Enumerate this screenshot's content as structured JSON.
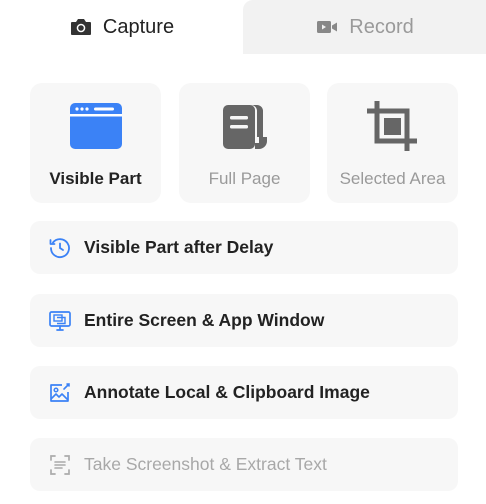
{
  "tabs": {
    "capture": {
      "label": "Capture",
      "icon": "camera-icon"
    },
    "record": {
      "label": "Record",
      "icon": "video-camera-icon"
    }
  },
  "cards": [
    {
      "label": "Visible Part",
      "icon": "browser-window-icon",
      "color": "#3b82f6",
      "enabled": true
    },
    {
      "label": "Full Page",
      "icon": "scroll-page-icon",
      "color": "#666666",
      "enabled": false
    },
    {
      "label": "Selected Area",
      "icon": "crop-icon",
      "color": "#666666",
      "enabled": false
    }
  ],
  "options": [
    {
      "label": "Visible Part after Delay",
      "icon": "delay-clock-icon",
      "enabled": true
    },
    {
      "label": "Entire Screen & App Window",
      "icon": "monitor-windows-icon",
      "enabled": true
    },
    {
      "label": "Annotate Local & Clipboard Image",
      "icon": "image-edit-icon",
      "enabled": true
    },
    {
      "label": "Take Screenshot & Extract Text",
      "icon": "scan-text-icon",
      "enabled": false
    }
  ],
  "colors": {
    "accent": "#3b82f6",
    "icon_gray": "#666666",
    "disabled_text": "#9a9a9a"
  }
}
